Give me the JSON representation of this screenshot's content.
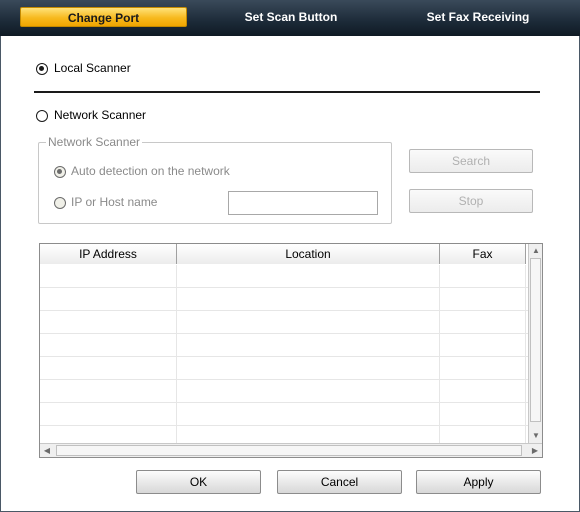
{
  "tabs": [
    {
      "label": "Change Port",
      "active": true
    },
    {
      "label": "Set Scan Button",
      "active": false
    },
    {
      "label": "Set Fax Receiving",
      "active": false
    }
  ],
  "local_scanner": {
    "label": "Local Scanner",
    "checked": true
  },
  "network_scanner": {
    "label": "Network Scanner",
    "checked": false
  },
  "network_group": {
    "title": "Network Scanner",
    "auto_detect": {
      "label": "Auto detection on the network",
      "checked": true
    },
    "ip_host": {
      "label": "IP or Host name",
      "checked": false
    },
    "ip_value": ""
  },
  "buttons": {
    "search": "Search",
    "stop": "Stop",
    "ok": "OK",
    "cancel": "Cancel",
    "apply": "Apply"
  },
  "table": {
    "columns": [
      "IP Address",
      "Location",
      "Fax"
    ],
    "rows": []
  },
  "colors": {
    "active_tab": "#f7b91e",
    "tab_bar": "#1c2a38"
  }
}
